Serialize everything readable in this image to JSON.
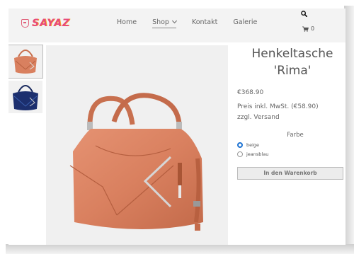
{
  "header": {
    "logo_text": "SAYAZ",
    "nav": [
      {
        "label": "Home"
      },
      {
        "label": "Shop"
      },
      {
        "label": "Kontakt"
      },
      {
        "label": "Galerie"
      }
    ],
    "cart_count": "0"
  },
  "product": {
    "title_line1": "Henkeltasche",
    "title_line2": "'Rima'",
    "price": "€368.90",
    "tax_note": "Preis inkl. MwSt. (€58.90) zzgl. Versand",
    "variant_label": "Farbe",
    "options": [
      {
        "label": "beige",
        "selected": true
      },
      {
        "label": "jeansblau",
        "selected": false
      }
    ],
    "add_to_cart": "In den Warenkorb"
  },
  "colors": {
    "bag_beige": "#d9805f",
    "bag_blue": "#1c2f6e",
    "accent": "#1e73d2",
    "logo": "#e84a7a"
  },
  "icons": {
    "search": "search-icon",
    "cart": "cart-icon",
    "dropdown": "chevron-down-icon"
  }
}
